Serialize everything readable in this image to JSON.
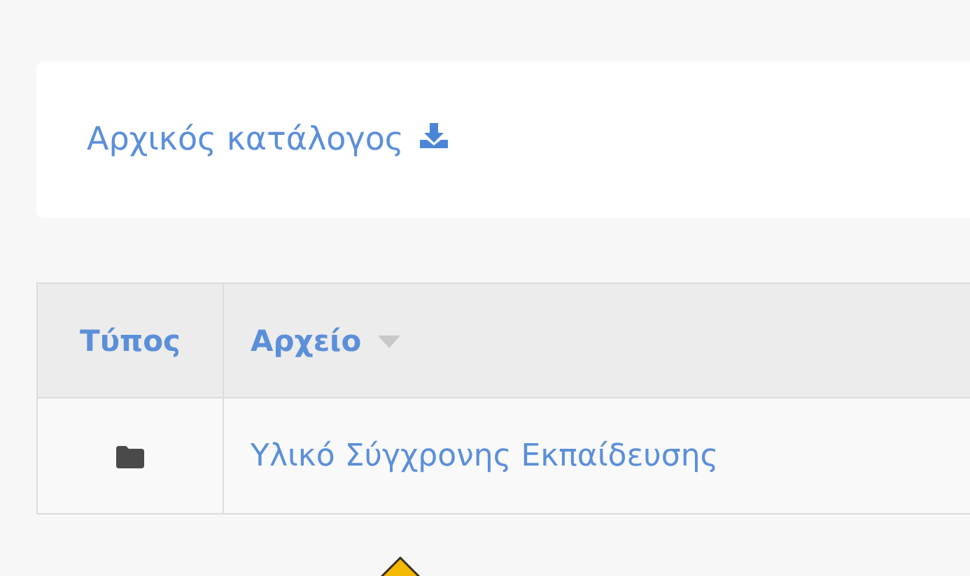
{
  "breadcrumb": {
    "label": "Αρχικός κατάλογος"
  },
  "table": {
    "columns": [
      {
        "label": "Τύπος",
        "sorted": false
      },
      {
        "label": "Αρχείο",
        "sorted": true
      }
    ],
    "rows": [
      {
        "kind": "folder",
        "name": "Υλικό Σύγχρονης Εκπαίδευσης"
      }
    ]
  }
}
